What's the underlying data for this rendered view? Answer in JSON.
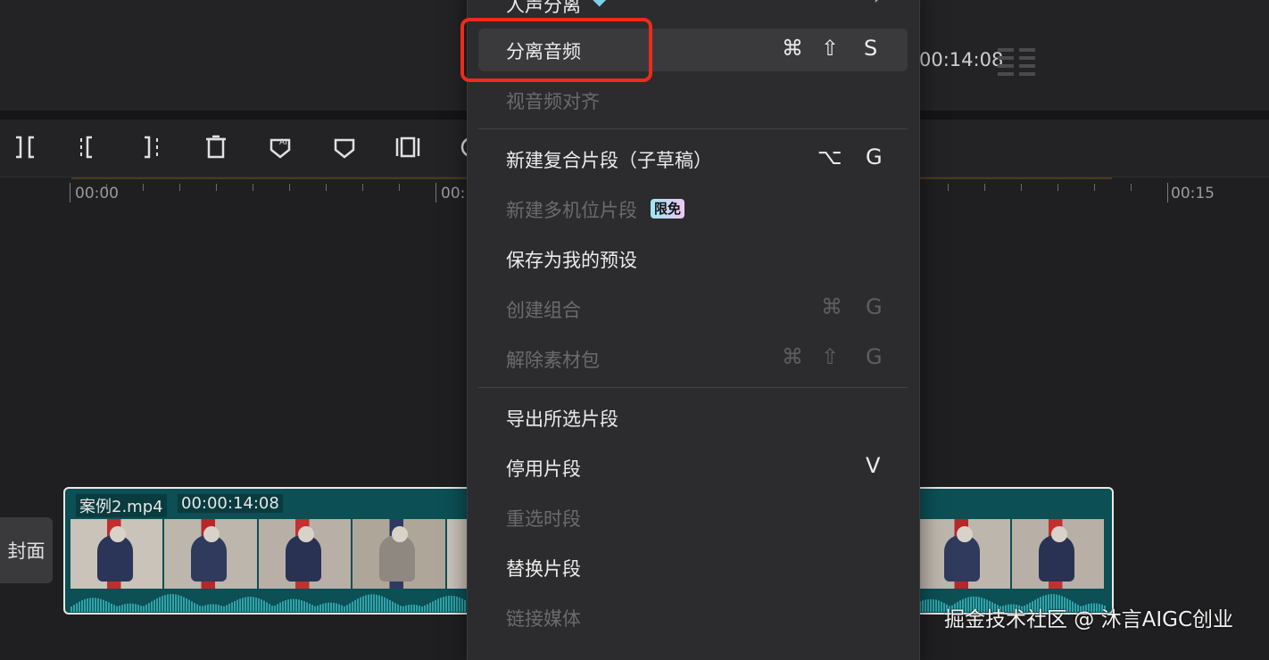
{
  "player": {
    "timecode": "00:14:08"
  },
  "ruler": {
    "labels": [
      "00:00",
      "00:",
      "00:15"
    ]
  },
  "track": {
    "cover_label": "封面",
    "clip_name": "案例2.mp4",
    "clip_duration": "00:00:14:08"
  },
  "menu": {
    "items": [
      {
        "label": "人声分离",
        "disabled": false,
        "submenu": true
      },
      {
        "label": "分离音频",
        "disabled": false,
        "shortcut": [
          "⌘",
          "⇧",
          "S"
        ]
      },
      {
        "label": "视音频对齐",
        "disabled": true
      },
      {
        "label": "新建复合片段（子草稿）",
        "disabled": false,
        "shortcut": [
          "⌥",
          "G"
        ]
      },
      {
        "label": "新建多机位片段",
        "disabled": true,
        "badge": "限免"
      },
      {
        "label": "保存为我的预设",
        "disabled": false
      },
      {
        "label": "创建组合",
        "disabled": true,
        "shortcut": [
          "⌘",
          "G"
        ]
      },
      {
        "label": "解除素材包",
        "disabled": true,
        "shortcut": [
          "⌘",
          "⇧",
          "G"
        ]
      },
      {
        "label": "导出所选片段",
        "disabled": false
      },
      {
        "label": "停用片段",
        "disabled": false,
        "shortcut": [
          "V"
        ]
      },
      {
        "label": "重选时段",
        "disabled": true
      },
      {
        "label": "替换片段",
        "disabled": false
      },
      {
        "label": "链接媒体",
        "disabled": true
      }
    ]
  },
  "watermark": "掘金技术社区 @ 沐言AIGC创业",
  "colors": {
    "highlight": "#f02a1a",
    "clip_bg": "#0c4f55",
    "menu_bg": "#2c2c2e"
  }
}
